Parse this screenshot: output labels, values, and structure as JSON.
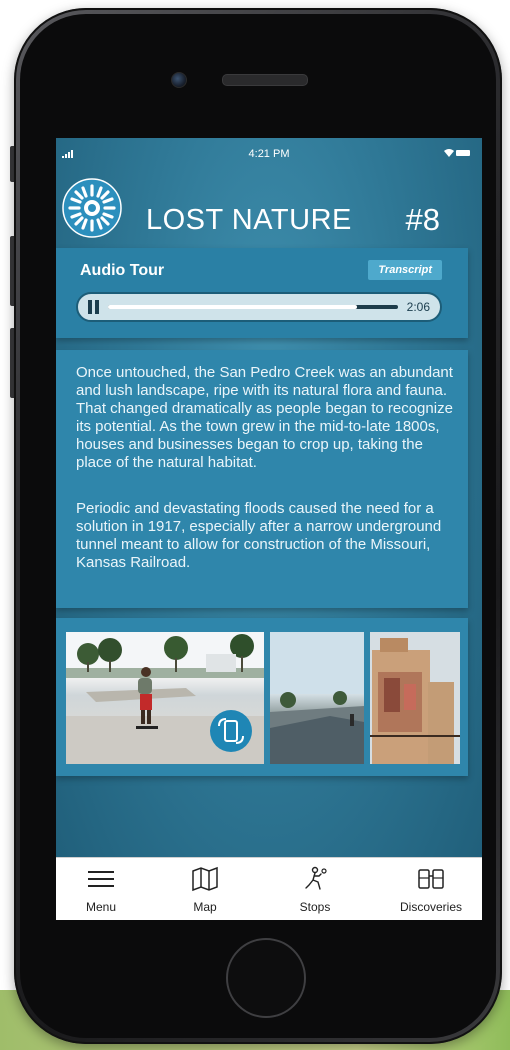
{
  "status_bar": {
    "time": "4:21 PM"
  },
  "header": {
    "title": "LOST NATURE",
    "number": "#8",
    "logo_icon": "sunburst-logo-icon"
  },
  "audio": {
    "title": "Audio Tour",
    "transcript_label": "Transcript",
    "time": "2:06",
    "progress": 0.86,
    "state": "playing"
  },
  "description": {
    "paragraphs": [
      "Once untouched, the San Pedro Creek was an abundant and lush landscape, ripe with its natural flora and fauna. That changed dramatically as people began to recognize its potential. As the town grew in the mid-to-late 1800s, houses and businesses began to crop up, taking the place of the natural habitat.",
      "Periodic and devastating floods caused the need for a solution in 1917, especially after a narrow underground tunnel meant to allow for construction of the Missouri, Kansas Railroad."
    ]
  },
  "gallery": {
    "share_icon": "phone-rotate-icon"
  },
  "tab_bar": {
    "items": [
      {
        "label": "Menu",
        "icon": "menu-icon"
      },
      {
        "label": "Map",
        "icon": "map-icon"
      },
      {
        "label": "Stops",
        "icon": "hiker-icon"
      },
      {
        "label": "Discoveries",
        "icon": "binoculars-icon"
      }
    ]
  },
  "colors": {
    "screen_bg": "#2f7896",
    "panel": "#2f86ab",
    "accent": "#4ea9cc"
  }
}
